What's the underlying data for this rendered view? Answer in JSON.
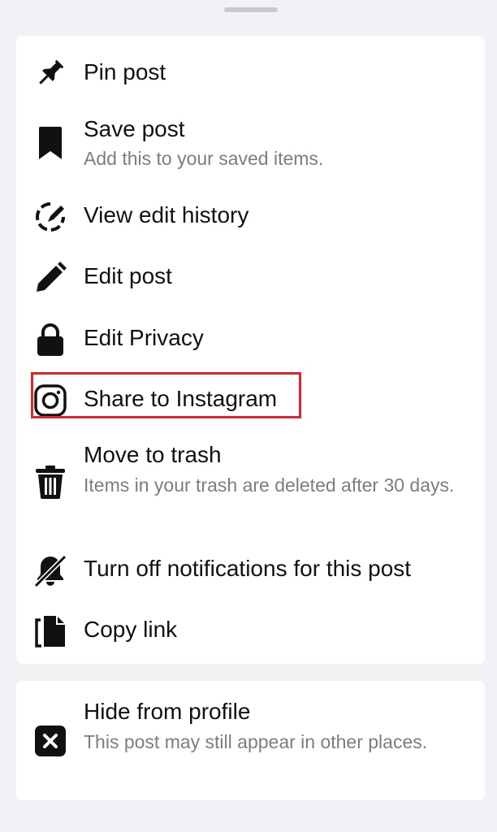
{
  "menu": {
    "items": [
      {
        "title": "Pin post",
        "icon": "pin-icon"
      },
      {
        "title": "Save post",
        "subtitle": "Add this to your saved items.",
        "icon": "bookmark-icon"
      },
      {
        "title": "View edit history",
        "icon": "edit-history-icon"
      },
      {
        "title": "Edit post",
        "icon": "pencil-icon"
      },
      {
        "title": "Edit Privacy",
        "icon": "lock-icon"
      },
      {
        "title": "Share to Instagram",
        "icon": "instagram-icon"
      },
      {
        "title": "Move to trash",
        "subtitle": "Items in your trash are deleted after 30 days.",
        "icon": "trash-icon"
      },
      {
        "title": "Turn off notifications for this post",
        "icon": "bell-off-icon"
      },
      {
        "title": "Copy link",
        "icon": "copy-icon"
      }
    ]
  },
  "secondary": {
    "title": "Hide from profile",
    "subtitle": "This post may still appear in other places.",
    "icon": "close-box-icon"
  },
  "colors": {
    "background": "#f1f2f6",
    "card": "#ffffff",
    "text": "#111111",
    "subtext": "#7a7d84",
    "highlight": "#e2242a"
  }
}
